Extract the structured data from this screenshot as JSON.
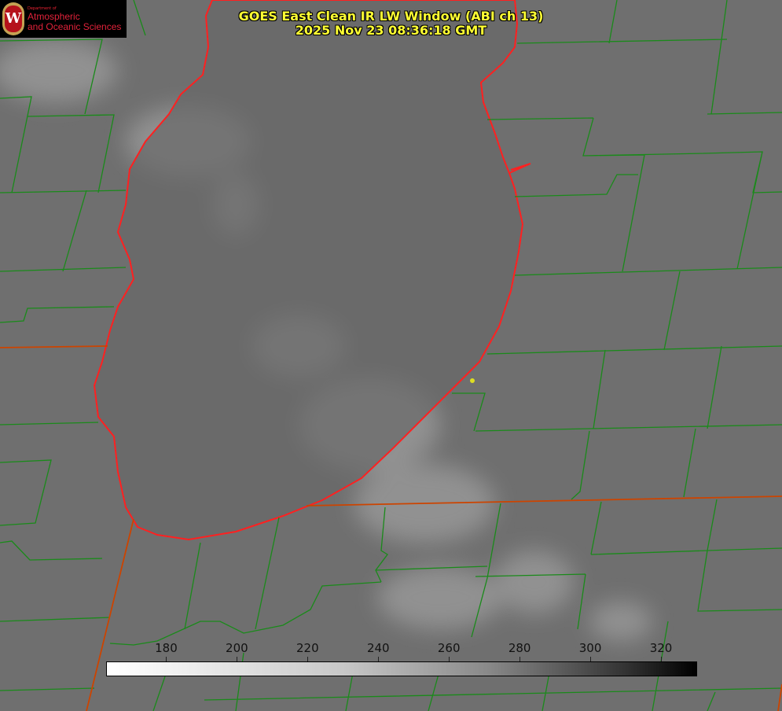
{
  "title": {
    "line1": "GOES East Clean IR LW Window (ABI ch 13)",
    "line2": "2025 Nov 23 08:36:18 GMT"
  },
  "logo": {
    "dept": "Department of",
    "line1": "Atmospheric",
    "line2": "and Oceanic Sciences",
    "seal_letter": "W"
  },
  "colorbar": {
    "min": 163,
    "max": 330,
    "ticks": [
      "180",
      "200",
      "220",
      "240",
      "260",
      "280",
      "300",
      "320"
    ],
    "tick_values": [
      180,
      200,
      220,
      240,
      260,
      280,
      300,
      320
    ]
  },
  "colors": {
    "lake_outline": "#ff2020",
    "county_lines": "#1a8a1a",
    "state_border": "#cc4400",
    "title": "#ffff33"
  }
}
